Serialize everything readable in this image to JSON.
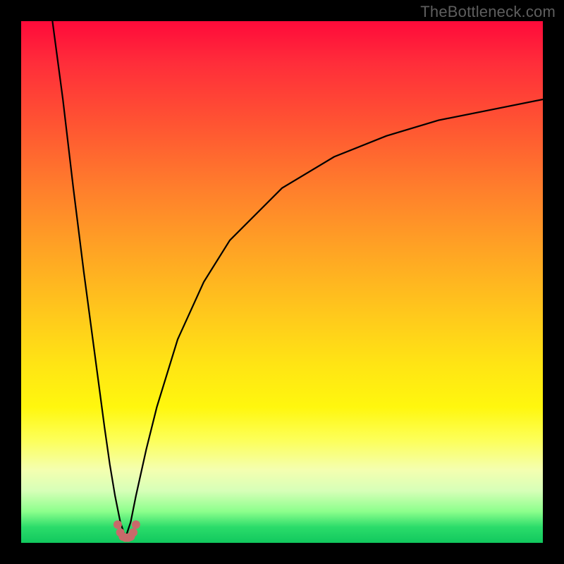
{
  "watermark": "TheBottleneck.com",
  "colors": {
    "frame": "#000000",
    "curve": "#000000",
    "marker": "#c86a6a"
  },
  "chart_data": {
    "type": "line",
    "title": "",
    "xlabel": "",
    "ylabel": "",
    "xlim": [
      0,
      100
    ],
    "ylim": [
      0,
      100
    ],
    "notch_x": 20,
    "series": [
      {
        "name": "left-branch",
        "x": [
          6,
          8,
          10,
          12,
          14,
          16,
          17,
          18,
          19,
          20
        ],
        "values": [
          100,
          85,
          68,
          52,
          37,
          22,
          15,
          9,
          4,
          1
        ]
      },
      {
        "name": "right-branch",
        "x": [
          20,
          21,
          22,
          24,
          26,
          30,
          35,
          40,
          50,
          60,
          70,
          80,
          90,
          100
        ],
        "values": [
          1,
          4,
          9,
          18,
          26,
          39,
          50,
          58,
          68,
          74,
          78,
          81,
          83,
          85
        ]
      }
    ],
    "markers": {
      "name": "bottom-cluster",
      "x": [
        18.5,
        19.0,
        19.5,
        20.0,
        20.5,
        21.0,
        21.5,
        22.0
      ],
      "values": [
        3.5,
        2.0,
        1.2,
        1.0,
        1.0,
        1.2,
        2.0,
        3.5
      ]
    }
  }
}
